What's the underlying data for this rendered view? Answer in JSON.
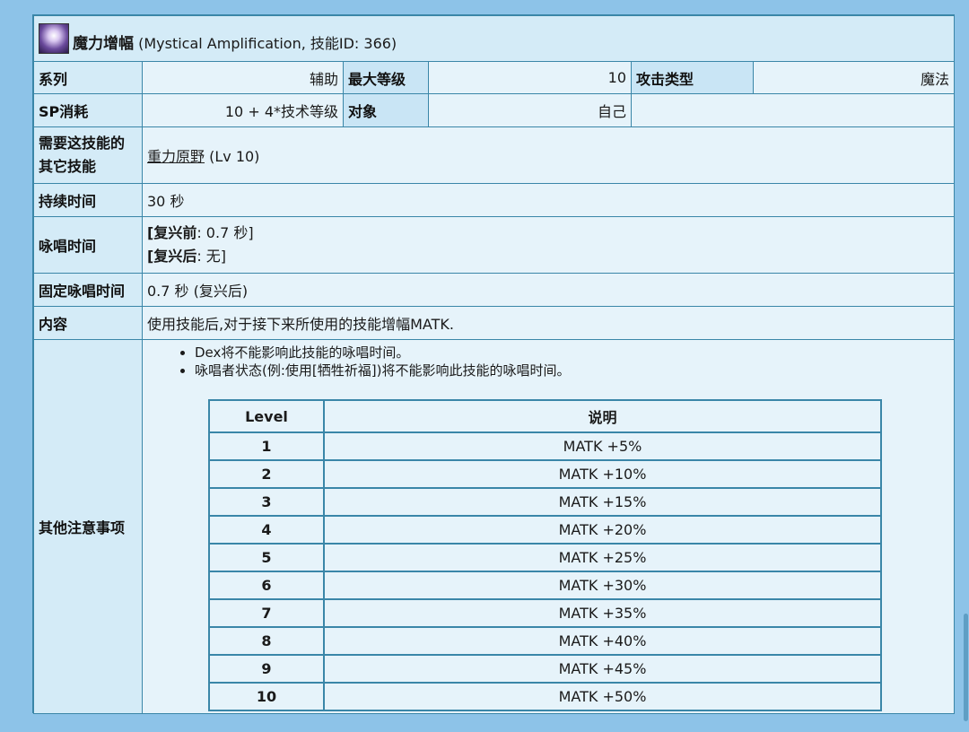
{
  "skill": {
    "name_cn": "魔力增幅",
    "subtitle": "(Mystical Amplification, 技能ID: 366)",
    "icon": "mystical-amplification-icon"
  },
  "row1": {
    "series_label": "系列",
    "series_value": "辅助",
    "max_level_label": "最大等级",
    "max_level_value": "10",
    "attack_type_label": "攻击类型",
    "attack_type_value": "魔法"
  },
  "row2": {
    "sp_label": "SP消耗",
    "sp_value": "10 + 4*技术等级",
    "target_label": "对象",
    "target_value": "自己"
  },
  "required": {
    "label": "需要这技能的其它技能",
    "skill_link": "重力原野",
    "skill_level": "(Lv 10)"
  },
  "duration": {
    "label": "持续时间",
    "value": "30 秒"
  },
  "cast_time": {
    "label": "咏唱时间",
    "line1_prefix": "[复兴前",
    "line1_value": ": 0.7 秒]",
    "line2_prefix": "[复兴后",
    "line2_value": ": 无]"
  },
  "fixed_cast": {
    "label": "固定咏唱时间",
    "value": "0.7 秒 (复兴后)"
  },
  "content": {
    "label": "内容",
    "value": "使用技能后,对于接下来所使用的技能增幅MATK."
  },
  "notes": {
    "label": "其他注意事项",
    "bullets": [
      "Dex将不能影响此技能的咏唱时间。",
      "咏唱者状态(例:使用[牺牲祈福])将不能影响此技能的咏唱时间。"
    ],
    "table_headers": [
      "Level",
      "说明"
    ],
    "levels": [
      {
        "level": "1",
        "desc": "MATK +5%"
      },
      {
        "level": "2",
        "desc": "MATK +10%"
      },
      {
        "level": "3",
        "desc": "MATK +15%"
      },
      {
        "level": "4",
        "desc": "MATK +20%"
      },
      {
        "level": "5",
        "desc": "MATK +25%"
      },
      {
        "level": "6",
        "desc": "MATK +30%"
      },
      {
        "level": "7",
        "desc": "MATK +35%"
      },
      {
        "level": "8",
        "desc": "MATK +40%"
      },
      {
        "level": "9",
        "desc": "MATK +45%"
      },
      {
        "level": "10",
        "desc": "MATK +50%"
      }
    ]
  }
}
